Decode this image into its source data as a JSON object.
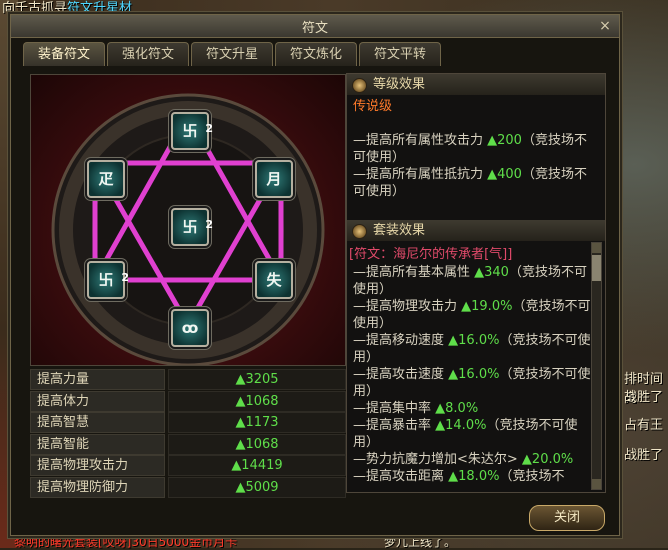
{
  "background": {
    "top_text": "向千古抓寻",
    "top_link": "符文升星材",
    "right_texts": [
      "排时间 亮",
      "战胜了",
      "占有王",
      "战胜了"
    ],
    "bottom_text": "黎明的曙光套装[哎呀]30日5000金币月卡",
    "bottom_right": "梦儿上线了。"
  },
  "window": {
    "title": "符文",
    "close_icon": "×",
    "tabs": [
      "装备符文",
      "强化符文",
      "符文升星",
      "符文炼化",
      "符文平转"
    ],
    "active_tab": 0
  },
  "runes": [
    {
      "glyph": "卐",
      "level": "2"
    },
    {
      "glyph": "疋",
      "level": ""
    },
    {
      "glyph": "月",
      "level": ""
    },
    {
      "glyph": "卐",
      "level": "2"
    },
    {
      "glyph": "卐",
      "level": "2"
    },
    {
      "glyph": "失",
      "level": ""
    },
    {
      "glyph": "ꝏ",
      "level": ""
    }
  ],
  "stats": [
    {
      "name": "提高力量",
      "value": "▲3205"
    },
    {
      "name": "提高体力",
      "value": "▲1068"
    },
    {
      "name": "提高智慧",
      "value": "▲1173"
    },
    {
      "name": "提高智能",
      "value": "▲1068"
    },
    {
      "name": "提高物理攻击力",
      "value": "▲14419"
    },
    {
      "name": "提高物理防御力",
      "value": "▲5009"
    }
  ],
  "level_effect": {
    "header": "等级效果",
    "grade": "传说级",
    "lines": [
      {
        "pre": "—提高所有属性攻击力 ",
        "val": "▲200",
        "post": "（竞技场不可使用）"
      },
      {
        "pre": "—提高所有属性抵抗力 ",
        "val": "▲400",
        "post": "（竞技场不可使用）"
      }
    ]
  },
  "set_effect": {
    "header": "套装效果",
    "set_name": "[符文：海尼尔的传承者[气]]",
    "lines": [
      {
        "pre": "—提高所有基本属性 ",
        "val": "▲340",
        "post": "（竞技场不可使用）"
      },
      {
        "pre": "—提高物理攻击力 ",
        "val": "▲19.0%",
        "post": "（竞技场不可使用）"
      },
      {
        "pre": "—提高移动速度 ",
        "val": "▲16.0%",
        "post": "（竞技场不可使用）"
      },
      {
        "pre": "—提高攻击速度 ",
        "val": "▲16.0%",
        "post": "（竞技场不可使用）"
      },
      {
        "pre": "—提高集中率 ",
        "val": "▲8.0%",
        "post": ""
      },
      {
        "pre": "—提高暴击率 ",
        "val": "▲14.0%",
        "post": "（竞技场不可使用）"
      },
      {
        "pre": "—势力抗魔力增加<朱达尔> ",
        "val": "▲20.0%",
        "post": ""
      },
      {
        "pre": "—提高攻击距离 ",
        "val": "▲18.0%",
        "post": "（竞技场不"
      }
    ]
  },
  "buttons": {
    "close": "关闭"
  }
}
